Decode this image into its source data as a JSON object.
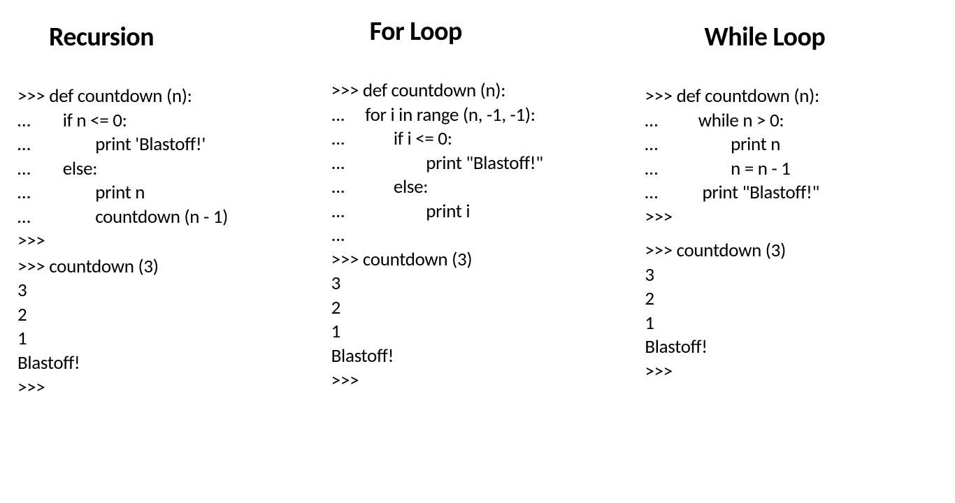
{
  "columns": [
    {
      "title": "Recursion",
      "code_def": ">>> def countdown (n):\n…        if n <= 0:\n…                print 'Blastoff!'\n…        else:\n…                print n\n…                countdown (n - 1)\n>>>",
      "code_call": ">>> countdown (3)\n3\n2\n1\nBlastoff!\n>>>"
    },
    {
      "title": "For  Loop",
      "code_def": ">>> def countdown (n):\n...     for i in range (n, -1, -1):\n...            if i <= 0:\n...                    print \"Blastoff!\"\n...            else:\n...                    print i\n...\n>>> countdown (3)\n3\n2\n1\nBlastoff!\n>>>",
      "code_call": ""
    },
    {
      "title": "While  Loop",
      "code_def": ">>> def countdown (n):\n…          while n > 0:\n…                  print n\n…                  n = n - 1\n…           print \"Blastoff!\"\n>>>",
      "code_call": ">>> countdown (3)\n3\n2\n1\nBlastoff!\n>>>"
    }
  ]
}
